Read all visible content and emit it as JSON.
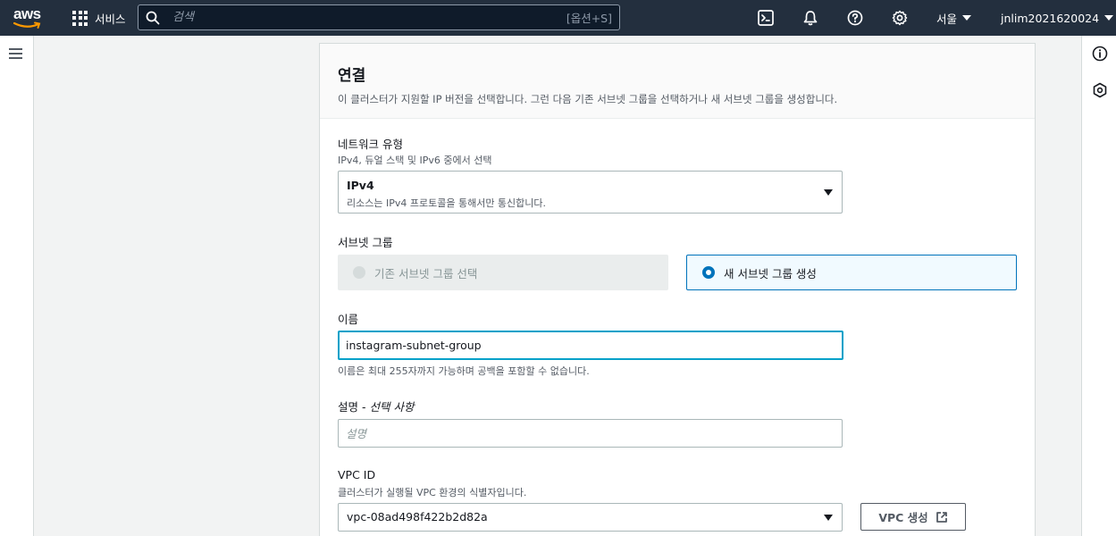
{
  "topnav": {
    "logo_text": "aws",
    "services_label": "서비스",
    "search_placeholder": "검색",
    "search_shortcut": "[옵션+S]",
    "region_label": "서울",
    "account_label": "jnlim2021620024"
  },
  "section": {
    "title": "연결",
    "description": "이 클러스터가 지원할 IP 버전을 선택합니다. 그런 다음 기존 서브넷 그룹을 선택하거나 새 서브넷 그룹을 생성합니다."
  },
  "network_type": {
    "label": "네트워크 유형",
    "description": "IPv4, 듀얼 스택 및 IPv6 중에서 선택",
    "selected_value": "IPv4",
    "selected_description": "리소스는 IPv4 프로토콜을 통해서만 통신합니다."
  },
  "subnet_group": {
    "label": "서브넷 그룹",
    "options": [
      {
        "label": "기존 서브넷 그룹 선택",
        "state": "disabled"
      },
      {
        "label": "새 서브넷 그룹 생성",
        "state": "selected"
      }
    ]
  },
  "name_field": {
    "label": "이름",
    "value": "instagram-subnet-group",
    "constraint": "이름은 최대 255자까지 가능하며 공백을 포함할 수 없습니다."
  },
  "description_field": {
    "label": "설명 - ",
    "label_optional": "선택 사항",
    "placeholder": "설명"
  },
  "vpc": {
    "label": "VPC ID",
    "description": "클러스터가 실행될 VPC 환경의 식별자입니다.",
    "selected_value": "vpc-08ad498f422b2d82a",
    "create_button_label": "VPC 생성"
  },
  "colors": {
    "nav_bg": "#232f3e",
    "accent_blue": "#0073bb",
    "focus_ring": "#00a1c9",
    "aws_orange": "#ff9900"
  }
}
